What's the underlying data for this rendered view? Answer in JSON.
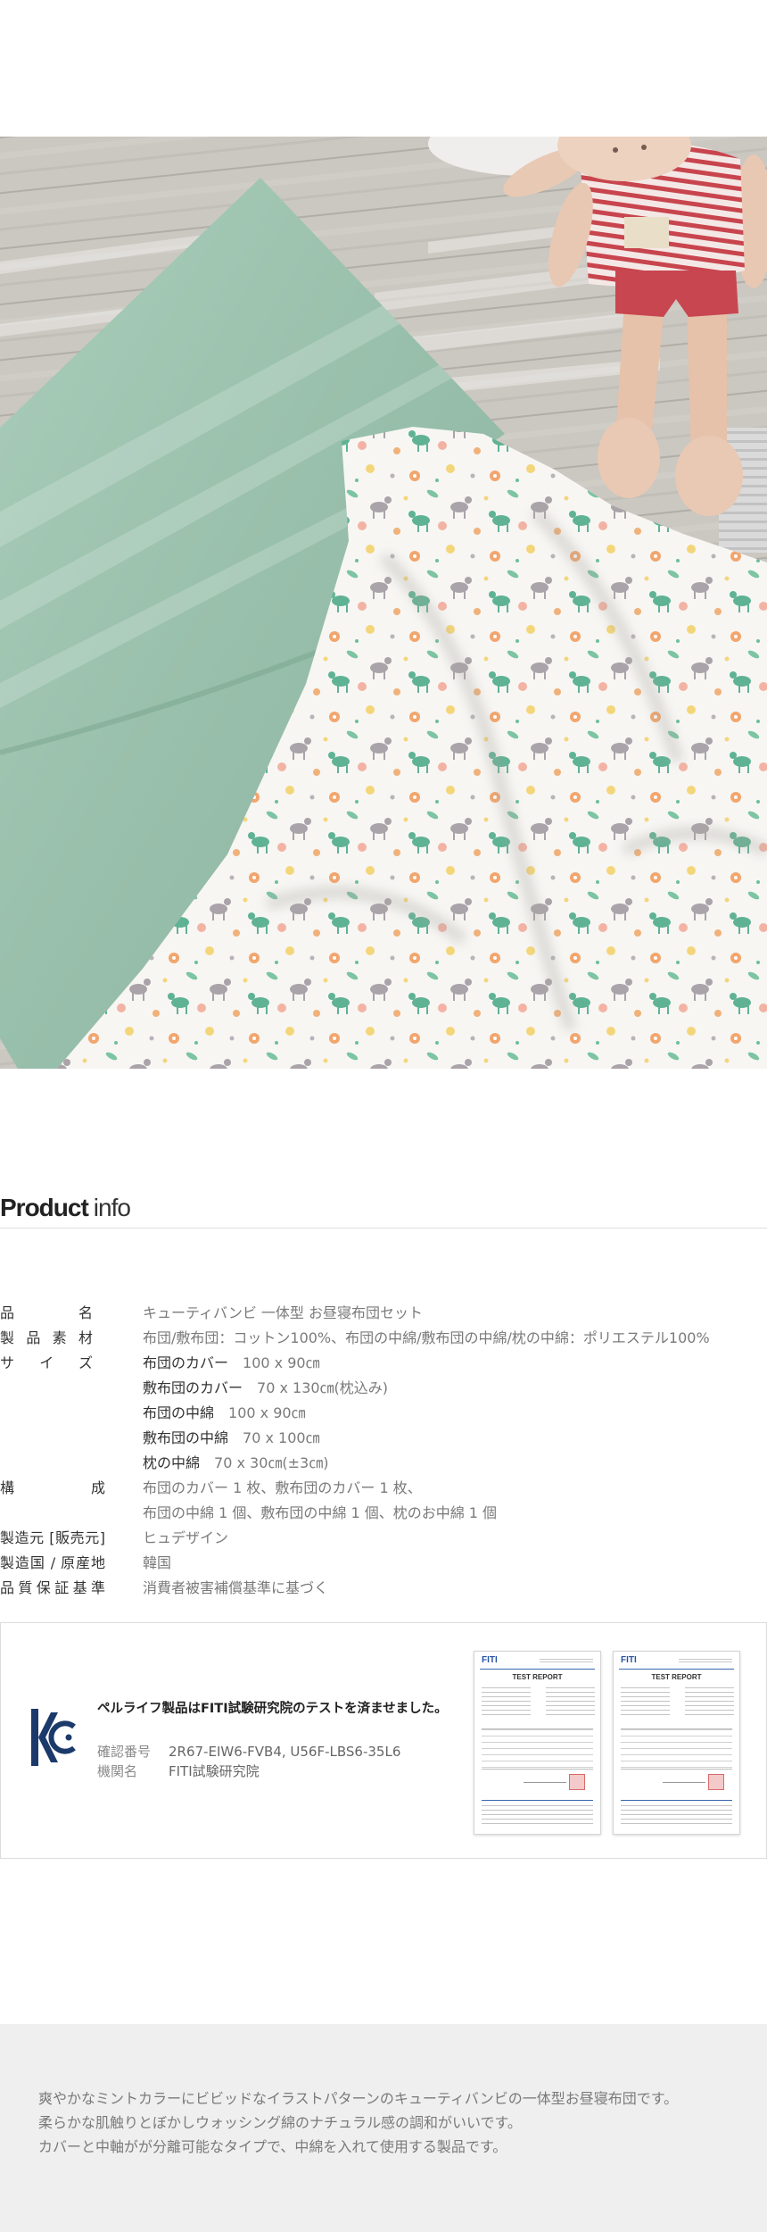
{
  "colors": {
    "mint": "#9cc2ae",
    "kc_navy": "#1b3a6b",
    "band_background": "#efefef"
  },
  "product_info": {
    "heading_bold": "Product",
    "heading_light": "info",
    "rows": [
      {
        "label": "品名",
        "value": "キューティバンビ 一体型 お昼寝布団セット"
      },
      {
        "label": "製品素材",
        "value": "布団/敷布団：コットン100%、布団の中綿/敷布団の中綿/枕の中綿：ポリエステル100%"
      },
      {
        "label": "サイズ"
      },
      {
        "label": "構成"
      },
      {
        "label": "製造元 [販売元]",
        "value": "ヒュデザイン"
      },
      {
        "label": "製造国 / 原産地",
        "value": "韓国"
      },
      {
        "label": "品質保証基準",
        "value": "消費者被害補償基準に基づく"
      }
    ],
    "sizes": [
      {
        "name": "布団のカバー",
        "size": "100 x 90㎝"
      },
      {
        "name": "敷布団のカバー",
        "size": "70 x 130㎝(枕込み)"
      },
      {
        "name": "布団の中綿",
        "size": "100 x 90㎝"
      },
      {
        "name": "敷布団の中綿",
        "size": "70 x 100㎝"
      },
      {
        "name": "枕の中綿",
        "size": "70 x 30㎝(±3㎝)"
      }
    ],
    "composition": [
      "布団のカバー 1 枚、敷布団のカバー 1 枚、",
      "布団の中綿 1 個、敷布団の中綿 1 個、枕のお中綿 1 個"
    ]
  },
  "certification": {
    "title": "ペルライフ製品はFITI試験研究院のテストを済ませました。",
    "confirm_label": "確認番号",
    "confirm_value": "2R67-EIW6-FVB4, U56F-LBS6-35L6",
    "org_label": "機関名",
    "org_value": "FITI試験研究院",
    "reports": [
      {
        "logo": "FITI",
        "title": "TEST REPORT"
      },
      {
        "logo": "FITI",
        "title": "TEST REPORT"
      }
    ]
  },
  "description": {
    "lines": [
      "爽やかなミントカラーにビビッドなイラストパターンのキューティバンビの一体型お昼寝布団です。",
      "柔らかな肌触りとぼかしウォッシング綿のナチュラル感の調和がいいです。",
      "カバーと中軸がが分離可能なタイプで、中綿を入れて使用する製品です。"
    ]
  }
}
